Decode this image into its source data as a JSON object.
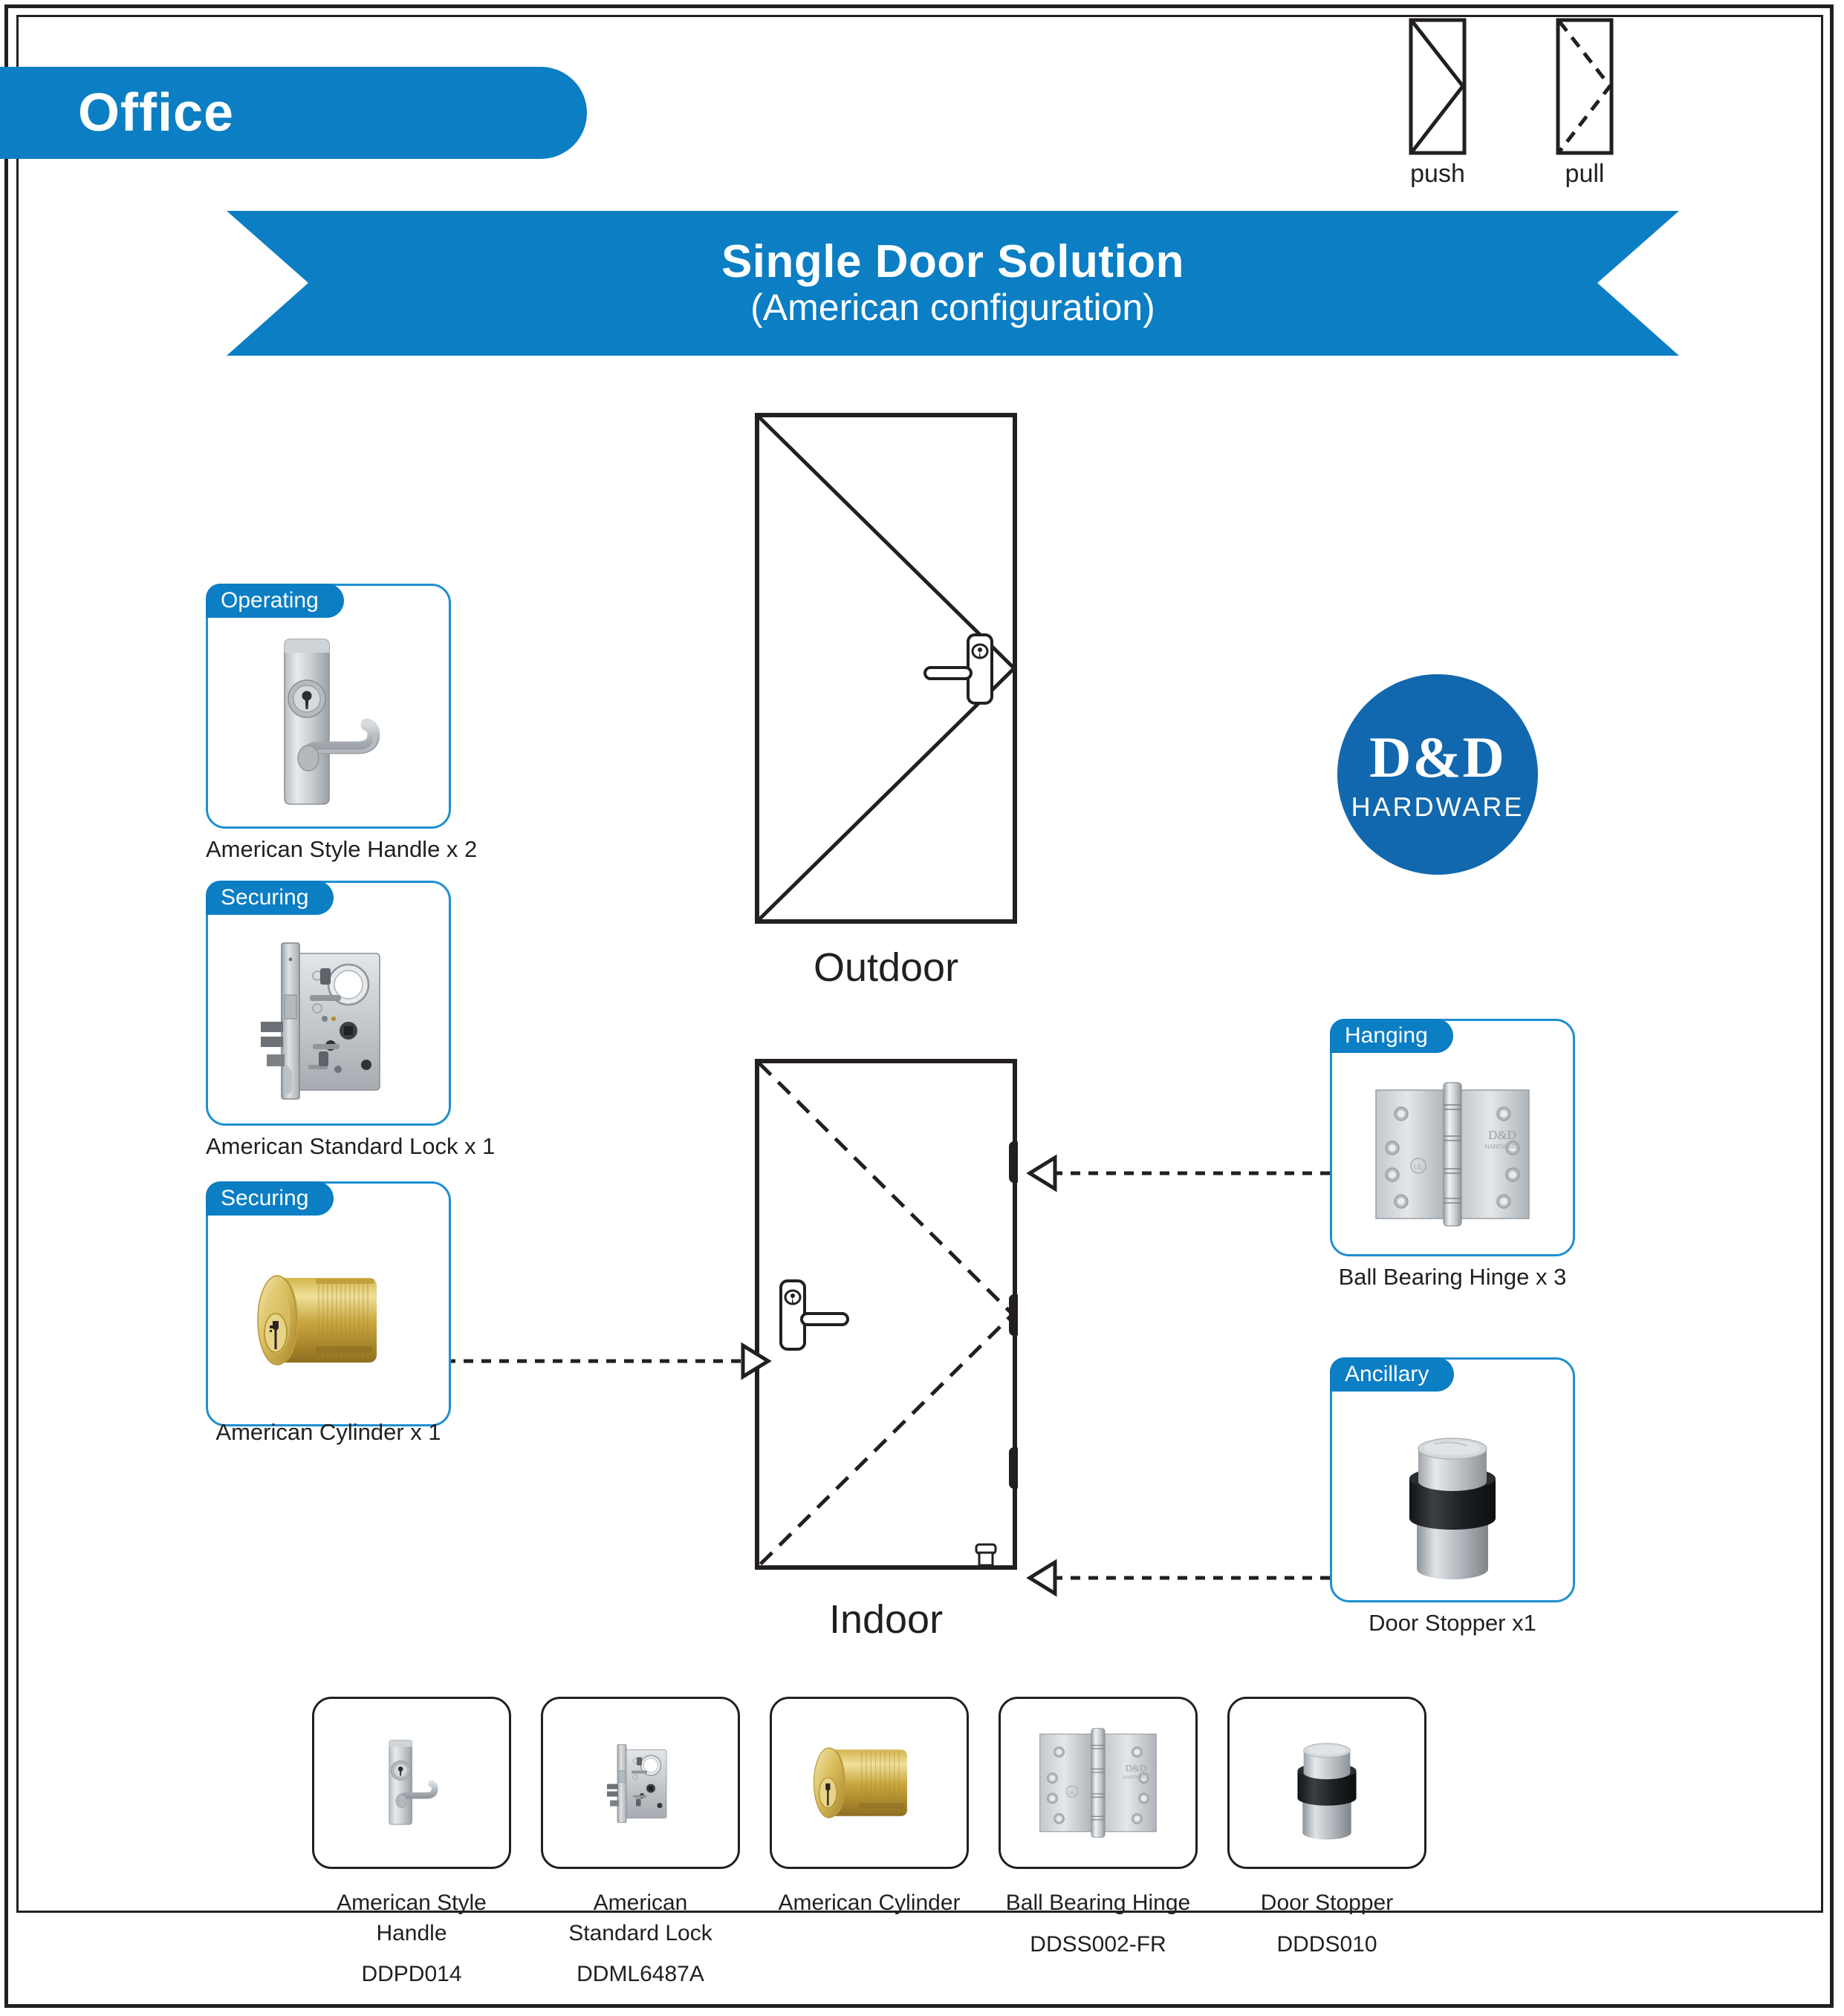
{
  "header": {
    "category_label": "Office",
    "banner_title": "Single Door Solution",
    "banner_subtitle": "(American configuration)"
  },
  "swing_symbols": [
    {
      "name": "push-symbol",
      "label": "push",
      "line_style": "solid"
    },
    {
      "name": "pull-symbol",
      "label": "pull",
      "line_style": "dashed"
    }
  ],
  "doors": {
    "outdoor": {
      "caption": "Outdoor",
      "line_style": "solid",
      "hinge_side": "left"
    },
    "indoor": {
      "caption": "Indoor",
      "line_style": "dashed",
      "hinge_side": "right"
    }
  },
  "logo": {
    "brand": "D&D",
    "sub": "HARDWARE",
    "color": "#1268ae"
  },
  "callouts": [
    {
      "name": "american-style-handle",
      "badge": "Operating",
      "caption": "American Style Handle x 2",
      "art": "lever-handle-plate"
    },
    {
      "name": "american-standard-lock",
      "badge": "Securing",
      "caption": "American Standard Lock x 1",
      "art": "mortise-lock-body"
    },
    {
      "name": "american-cylinder",
      "badge": "Securing",
      "caption": "American Cylinder x 1",
      "art": "brass-cylinder"
    },
    {
      "name": "ball-bearing-hinge",
      "badge": "Hanging",
      "caption": "Ball Bearing Hinge x 3",
      "art": "butt-hinge"
    },
    {
      "name": "door-stopper",
      "badge": "Ancillary",
      "caption": "Door Stopper x1",
      "art": "floor-door-stop"
    }
  ],
  "legend": [
    {
      "name": "american-style-handle",
      "label": "American Style Handle",
      "code": "DDPD014",
      "art": "lever-handle-plate"
    },
    {
      "name": "american-standard-lock",
      "label": "American\nStandard Lock",
      "code": "DDML6487A",
      "art": "mortise-lock-body"
    },
    {
      "name": "american-cylinder",
      "label": "American Cylinder",
      "code": "",
      "art": "brass-cylinder"
    },
    {
      "name": "ball-bearing-hinge",
      "label": "Ball Bearing Hinge",
      "code": "DDSS002-FR",
      "art": "butt-hinge"
    },
    {
      "name": "door-stopper",
      "label": "Door Stopper",
      "code": "DDDS010",
      "art": "floor-door-stop"
    }
  ],
  "colors": {
    "brand_blue": "#0b7ec4",
    "card_border_blue": "#1f8fd0",
    "logo_blue": "#1268ae",
    "ink": "#231f20"
  }
}
